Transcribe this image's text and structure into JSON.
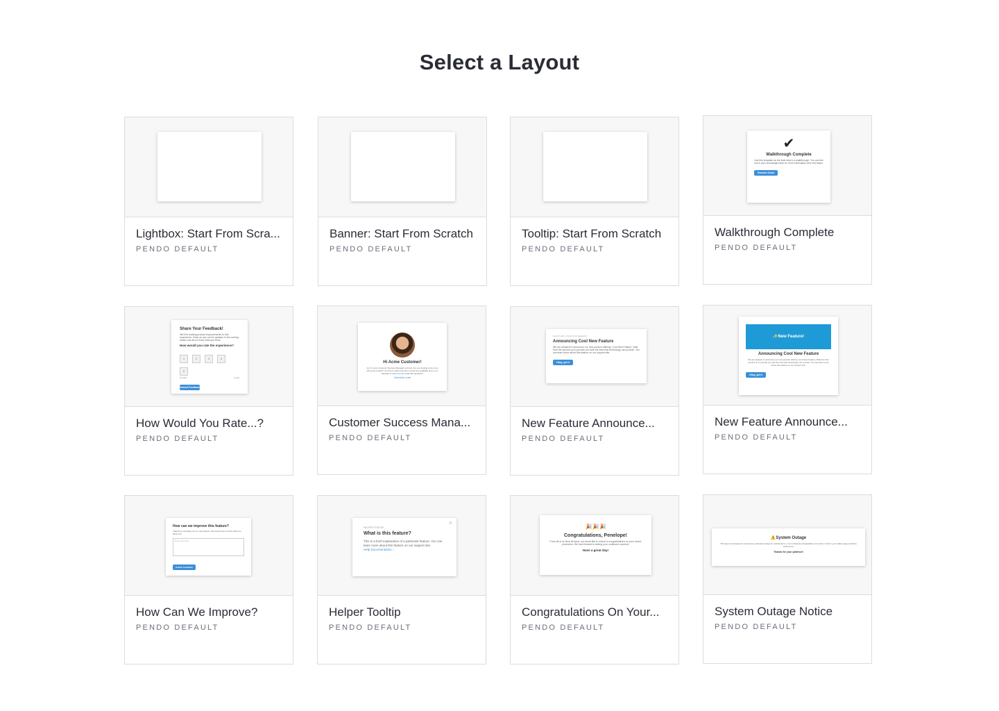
{
  "page": {
    "title": "Select a Layout"
  },
  "cards": [
    {
      "title": "Lightbox: Start From Scra...",
      "subtitle": "PENDO DEFAULT"
    },
    {
      "title": "Banner: Start From Scratch",
      "subtitle": "PENDO DEFAULT"
    },
    {
      "title": "Tooltip: Start From Scratch",
      "subtitle": "PENDO DEFAULT"
    },
    {
      "title": "Walkthrough Complete",
      "subtitle": "PENDO DEFAULT",
      "preview": {
        "heading": "Walkthrough Complete",
        "body": "Use this template as the final step in a walkthrough. You can link out to your knowledge base for more information and next steps.",
        "button": "Dismiss Guide"
      }
    },
    {
      "title": "How Would You Rate...?",
      "subtitle": "PENDO DEFAULT",
      "preview": {
        "heading": "Share Your Feedback!",
        "body": "We'll be making product improvements to this experience. Keep an eye out for updates in the coming weeks and let us know what you think.",
        "question": "How would you rate the experience?",
        "scale": [
          "1",
          "2",
          "3",
          "4",
          "5"
        ],
        "low_label": "Horrible",
        "high_label": "Great",
        "button": "Submit Feedback"
      }
    },
    {
      "title": "Customer Success Mana...",
      "subtitle": "PENDO DEFAULT",
      "preview": {
        "heading": "Hi Acme Customer!",
        "body": "Hi, I'm your Customer Success Manager at Acme. Are you looking to do more with your product? I'm here to help! Feel free to book any available slot on my calendar or shoot me an email with questions.",
        "link": "Schedule a call"
      }
    },
    {
      "title": "New Feature Announce...",
      "subtitle": "PENDO DEFAULT",
      "preview": {
        "eyebrow": "FEATURE ANNOUNCEMENT",
        "heading": "Announcing Cool New Feature",
        "body": "We are pleased to announce our new product offering: Cool New Feature. Built from the ground up to provide you with the best that technology can provide. You can learn more about this feature on our support site.",
        "button": "Okay, got it"
      }
    },
    {
      "title": "New Feature Announce...",
      "subtitle": "PENDO DEFAULT",
      "preview": {
        "banner": "✨New Feature!",
        "heading": "Announcing Cool New Feature",
        "body": "We are pleased to announce our new product offering: Cool New Feature. Built from the ground up to provide you with the best that technology can provide. You can learn more about this feature on our support site.",
        "button": "Okay, got it"
      }
    },
    {
      "title": "How Can We Improve?",
      "subtitle": "PENDO DEFAULT",
      "preview": {
        "heading": "How can we improve this feature?",
        "body": "Thanks for checking out our new feature. We would love to know what you think of it!",
        "placeholder": "Enter text here...",
        "button": "Submit Feedback"
      }
    },
    {
      "title": "Helper Tooltip",
      "subtitle": "PENDO DEFAULT",
      "preview": {
        "eyebrow": "HELPER TOOLTIP",
        "heading": "What is this feature?",
        "body": "This is a brief explanation of a particular feature. You can learn more about this feature on our support site.",
        "link": "Help Documentation ›"
      }
    },
    {
      "title": "Congratulations On Your...",
      "subtitle": "PENDO DEFAULT",
      "preview": {
        "emoji": "🎉🎉🎉",
        "heading": "Congratulations, Penelope!",
        "body": "From all of us here at Acme, we would like to extend a congratulations on your recent promotion. We look forward to seeing your continued success!",
        "footer": "Have a great day!"
      }
    },
    {
      "title": "System Outage Notice",
      "subtitle": "PENDO DEFAULT",
      "preview": {
        "heading": "⚠️System Outage",
        "body": "This layout is designed to announce a planned outage for maintenance, or an unforeseen degradation of service. A link to your status page would be useful here.",
        "footer": "Thanks for your patience!"
      }
    }
  ],
  "colors": {
    "accent": "#3b8fd9",
    "banner": "#1e9ad6",
    "card_border": "#dadce5",
    "thumb_bg": "#f7f7f7"
  }
}
